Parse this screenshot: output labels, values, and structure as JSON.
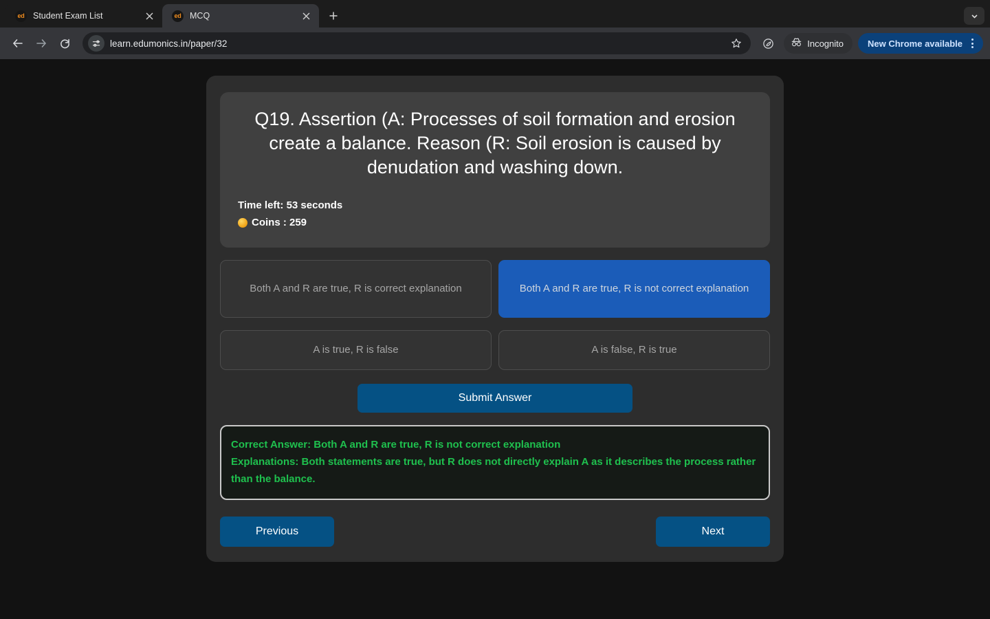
{
  "browser": {
    "tabs": [
      {
        "title": "Student Exam List",
        "favicon_text": "ed",
        "favicon_name": "edumonics-favicon",
        "active": false
      },
      {
        "title": "MCQ",
        "favicon_text": "ed",
        "favicon_name": "edumonics-favicon",
        "active": true
      }
    ],
    "new_tab_label": "+",
    "toolbar": {
      "back_label": "Back",
      "forward_label": "Forward",
      "reload_label": "Reload",
      "url": "learn.edumonics.in/paper/32",
      "url_placeholder": "Search Google or type a URL",
      "bookmark_label": "Bookmark this tab",
      "incognito_label": "Incognito",
      "update_label": "New Chrome available",
      "menu_label": "Customize and control Google Chrome"
    },
    "colors": {
      "tabstrip_bg": "#1c1c1c",
      "toolbar_bg": "#35363a",
      "active_tab_bg": "#35363a",
      "omnibox_bg": "#202124",
      "update_pill_bg": "#0b417a",
      "update_pill_text": "#cfe3ff"
    }
  },
  "quiz": {
    "question": "Q19. Assertion (A: Processes of soil formation and erosion create a balance. Reason (R: Soil erosion is caused by denudation and washing down.",
    "timer_label": "Time left: 53 seconds",
    "coins_label": "Coins : 259",
    "options": [
      {
        "label": "Both A and R are true, R is correct explanation",
        "selected": false
      },
      {
        "label": "Both A and R are true, R is not correct explanation",
        "selected": true
      },
      {
        "label": "A is true, R is false",
        "selected": false
      },
      {
        "label": "A is false, R is true",
        "selected": false
      }
    ],
    "submit_label": "Submit Answer",
    "feedback": {
      "correct_answer_line": "Correct Answer: Both A and R are true, R is not correct explanation",
      "explanation_line": "Explanations: Both statements are true, but R does not directly explain A as it describes the process rather than the balance."
    },
    "previous_label": "Previous",
    "next_label": "Next",
    "colors": {
      "page_bg": "#121212",
      "shell_bg": "#2d2d2d",
      "question_card_bg": "#404040",
      "option_bg": "#333333",
      "option_selected_bg": "#1b5cb8",
      "primary_button_bg": "#055184",
      "feedback_text": "#1fc04e",
      "feedback_border": "#c9c9c9",
      "coin_color": "#f2a71b"
    }
  }
}
